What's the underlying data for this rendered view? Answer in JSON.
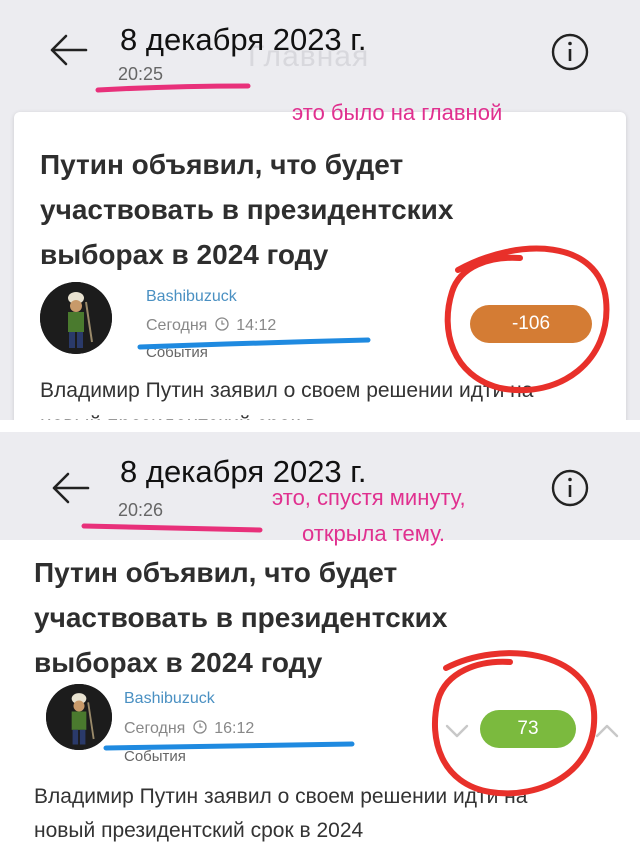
{
  "top": {
    "date": "8 декабря 2023 г.",
    "time": "20:25",
    "ghost_title": "Главная",
    "post": {
      "title": "Путин объявил, что будет участвовать в президентских выборах в 2024 году",
      "author": "Bashibuzuck",
      "meta_day": "Сегодня",
      "meta_time": "14:12",
      "category": "События",
      "excerpt": "Владимир Путин заявил о своем решении идти на новый президентский срок в",
      "score": "-106"
    },
    "annotation": "это было на главной"
  },
  "bottom": {
    "date": "8 декабря 2023 г.",
    "time": "20:26",
    "post": {
      "title": "Путин объявил, что будет участвовать в президентских выборах в 2024 году",
      "author": "Bashibuzuck",
      "meta_day": "Сегодня",
      "meta_time": "16:12",
      "category": "События",
      "excerpt": "Владимир Путин заявил о своем решении идти на новый президентский срок в 2024",
      "score": "73"
    },
    "annotation_line1": "это, спустя минуту,",
    "annotation_line2": "открыла тему."
  },
  "colors": {
    "score_negative": "#d47c34",
    "score_positive": "#7bba3e",
    "author_link": "#4a90c2",
    "annotation_text": "#e0308f",
    "marker_pink": "#e8307a",
    "marker_blue": "#1f8ae0",
    "marker_red": "#e8302a"
  },
  "icons": [
    "back-arrow-icon",
    "info-icon",
    "clock-icon",
    "chevron-down-icon",
    "chevron-up-icon"
  ]
}
